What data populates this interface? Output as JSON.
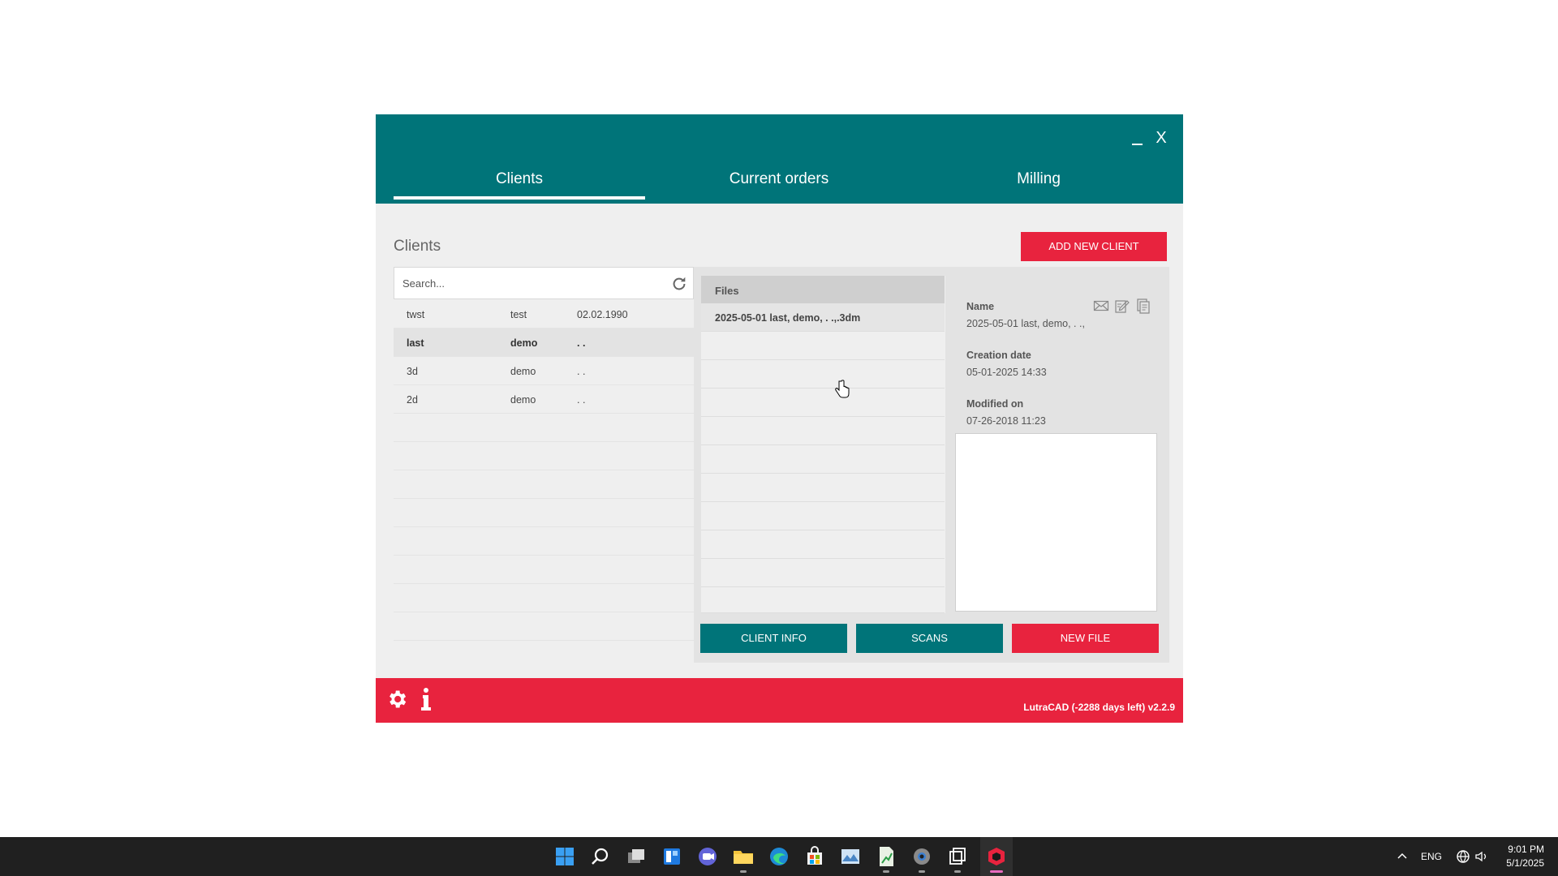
{
  "window": {
    "minimize_label": "_",
    "close_label": "X"
  },
  "tabs": [
    {
      "label": "Clients",
      "active": true
    },
    {
      "label": "Current orders",
      "active": false
    },
    {
      "label": "Milling",
      "active": false
    }
  ],
  "clients_section": {
    "title": "Clients",
    "add_button": "ADD NEW CLIENT",
    "search_placeholder": "Search...",
    "rows": [
      {
        "last": "twst",
        "first": "test",
        "date": "02.02.1990"
      },
      {
        "last": "last",
        "first": "demo",
        "date": ". ."
      },
      {
        "last": "3d",
        "first": "demo",
        "date": ". ."
      },
      {
        "last": "2d",
        "first": "demo",
        "date": ". ."
      }
    ],
    "selected_index": 1
  },
  "files": {
    "header": "Files",
    "items": [
      "2025-05-01 last, demo, . .,.3dm"
    ]
  },
  "details": {
    "name_label": "Name",
    "name_value": "2025-05-01 last, demo, . .,",
    "creation_label": "Creation date",
    "creation_value": "05-01-2025 14:33",
    "modified_label": "Modified on",
    "modified_value": "07-26-2018 11:23"
  },
  "buttons": {
    "client_info": "CLIENT INFO",
    "scans": "SCANS",
    "new_file": "NEW FILE"
  },
  "footer": {
    "version": "LutraCAD (-2288 days left) v2.2.9"
  },
  "colors": {
    "header_teal": "#007479",
    "accent_red": "#e8233e",
    "panel_gray": "#efefef"
  },
  "taskbar": {
    "language": "ENG",
    "time": "9:01 PM",
    "date": "5/1/2025",
    "icons": [
      "windows-start-icon",
      "search-icon",
      "task-view-icon",
      "widgets-icon",
      "teams-chat-icon",
      "file-explorer-icon",
      "edge-icon",
      "store-icon",
      "photo-viewer-icon",
      "spreadsheet-icon",
      "settings-icon",
      "window-manager-icon",
      "lutracad-icon"
    ]
  }
}
